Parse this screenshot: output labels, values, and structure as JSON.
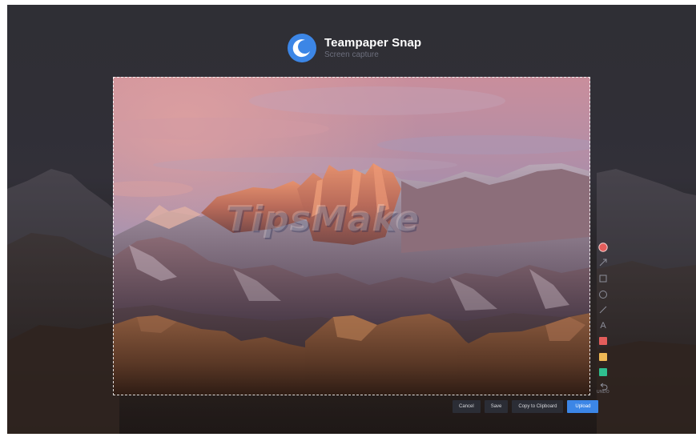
{
  "app": {
    "title": "Teampaper Snap",
    "subtitle": "Screen capture",
    "logo_icon": "moon-logo-icon"
  },
  "watermark": {
    "text": "TipsMake"
  },
  "toolbar": {
    "tools": [
      {
        "name": "record-dot-icon",
        "label": ""
      },
      {
        "name": "arrow-icon",
        "label": ""
      },
      {
        "name": "rectangle-icon",
        "label": ""
      },
      {
        "name": "circle-icon",
        "label": ""
      },
      {
        "name": "line-icon",
        "label": ""
      },
      {
        "name": "text-icon",
        "label": "A"
      },
      {
        "name": "color-red",
        "label": "",
        "color": "#e35d5b"
      },
      {
        "name": "color-yellow",
        "label": "",
        "color": "#f0b955"
      },
      {
        "name": "color-green",
        "label": "",
        "color": "#2fbf8f"
      },
      {
        "name": "undo-icon",
        "label": "UNDO"
      }
    ],
    "text_tool_label": "A",
    "undo_label": "UNDO"
  },
  "actions": {
    "cancel_label": "Cancel",
    "save_label": "Save",
    "copy_label": "Copy to Clipboard",
    "upload_label": "Upload"
  },
  "colors": {
    "accent": "#3c86e6",
    "record": "#e35d5b",
    "red": "#e35d5b",
    "yellow": "#f0b955",
    "green": "#2fbf8f",
    "panel": "#2b2d35"
  }
}
